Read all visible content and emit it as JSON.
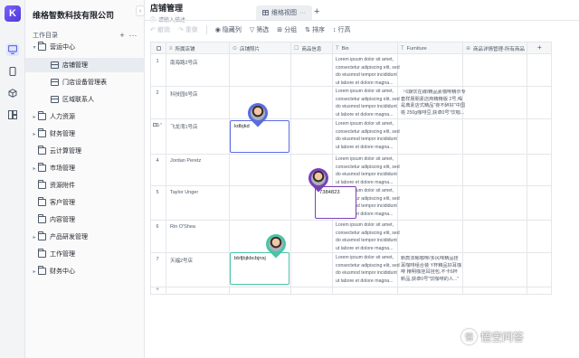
{
  "app": {
    "company_name": "维格智数科技有限公司",
    "logo_letter": "K",
    "collapse_glyph": "‹"
  },
  "directory": {
    "title": "工作目录",
    "add_glyph": "+",
    "more_glyph": "···",
    "items": [
      {
        "label": "营运中心",
        "caret": "▾",
        "type": "folder",
        "level": 0
      },
      {
        "label": "店铺管理",
        "caret": "",
        "type": "sheet",
        "level": 1,
        "selected": true
      },
      {
        "label": "门店设备管理表",
        "caret": "",
        "type": "sheet",
        "level": 1
      },
      {
        "label": "区域联系人",
        "caret": "",
        "type": "sheet",
        "level": 1
      },
      {
        "label": "人力资源",
        "caret": "▸",
        "type": "folder",
        "level": 0
      },
      {
        "label": "财务管理",
        "caret": "▸",
        "type": "folder",
        "level": 0
      },
      {
        "label": "云计算管理",
        "caret": "",
        "type": "folder",
        "level": 0
      },
      {
        "label": "市场管理",
        "caret": "▸",
        "type": "folder",
        "level": 0
      },
      {
        "label": "资源附件",
        "caret": "",
        "type": "folder",
        "level": 0
      },
      {
        "label": "客户管理",
        "caret": "",
        "type": "folder",
        "level": 0
      },
      {
        "label": "内容管理",
        "caret": "",
        "type": "folder",
        "level": 0
      },
      {
        "label": "产品研发管理",
        "caret": "▸",
        "type": "folder",
        "level": 0
      },
      {
        "label": "工作管理",
        "caret": "",
        "type": "folder",
        "level": 0
      },
      {
        "label": "财务中心",
        "caret": "▸",
        "type": "folder",
        "level": 0
      }
    ]
  },
  "header": {
    "sheet_name": "店铺管理",
    "sheet_desc": "请输入描述",
    "view_tab_label": "维格视图",
    "view_tab_more": "···",
    "add_view_glyph": "+"
  },
  "toolbar": {
    "undo": "撤销",
    "redo": "重做",
    "hide_columns": "隐藏列",
    "filter": "筛选",
    "group": "分组",
    "sort": "排序",
    "row_height": "行高"
  },
  "grid": {
    "columns": [
      {
        "icon": "≡",
        "label": "所属店铺"
      },
      {
        "icon": "⊙",
        "label": "店铺照片"
      },
      {
        "icon": "☐",
        "label": "商品信息"
      },
      {
        "icon": "T",
        "label": "Bio"
      },
      {
        "icon": "T",
        "label": "Furniture"
      },
      {
        "icon": "⊕",
        "label": "商品详情管理-所有商品"
      }
    ],
    "add_column_glyph": "+",
    "rows": [
      {
        "num": "1",
        "name": "南海路2号店",
        "lorem": [
          "Lorem ipsum dolor sit amet,",
          "consectetur adipiscing elit, sed",
          "do eiusmod tempor incididunt",
          "ut labore et dolore magna..."
        ],
        "furniture": []
      },
      {
        "num": "2",
        "name": "科技园6号店",
        "lorem": [
          "Lorem ipsum dolor sit amet,",
          "consectetur adipiscing elit, sed",
          "do eiusmod tempor incididunt",
          "ut labore et dolore magna..."
        ],
        "furniture": [
          "「6期饮在線/精品素咖啡精示专",
          "套样朋朋素店商精精版 2号,喝",
          "是典素店式精品\"夜不醉好\"中国",
          "桃 250g咖啡豆,获卓0号\"饮咖..."
        ]
      },
      {
        "num": "3",
        "name": "飞龙湾1号店",
        "lorem": [
          "Lorem ipsum dolor sit amet,",
          "consectetur adipiscing elit, sed",
          "do eiusmod tempor incididunt",
          "ut labore et dolore magna..."
        ],
        "furniture": []
      },
      {
        "num": "4",
        "name": "Jordan Peretz",
        "lorem": [
          "Lorem ipsum dolor sit amet,",
          "consectetur adipiscing elit, sed",
          "do eiusmod tempor incididunt",
          "ut labore et dolore magna..."
        ],
        "furniture": []
      },
      {
        "num": "5",
        "name": "Taylor Unger",
        "lorem": [
          "Lorem ipsum dolor sit amet,",
          "consectetur adipiscing elit, sed",
          "do eiusmod tempor incididunt",
          "ut labore et dolore magna..."
        ],
        "furniture": []
      },
      {
        "num": "6",
        "name": "Rin O'Shea",
        "lorem": [
          "Lorem ipsum dolor sit amet,",
          "consectetur adipiscing elit, sed",
          "do eiusmod tempor incididunt",
          "ut labore et dolore magna..."
        ],
        "furniture": []
      },
      {
        "num": "7",
        "name": "天福2号店",
        "lorem": [
          "Lorem ipsum dolor sit amet,",
          "consectetur adipiscing elit, sed",
          "do eiusmod tempor incididunt",
          "ut labore et dolore magna..."
        ],
        "furniture": [
          "新款浓郁咖啡/多风味精品挂",
          "耳咖啡组合装 Y杯精品好耳咖",
          "啡 精明咖挂耳挂包,不卡6杯",
          "新品,获卓0号\"饮咖啡的人...\""
        ]
      }
    ],
    "add_row_glyph": "+"
  },
  "collab": {
    "editors": [
      {
        "color": "#5b6be0",
        "text": "kdbjkd"
      },
      {
        "color": "#7a3fb8",
        "text": "7384823"
      },
      {
        "color": "#4bc4a7",
        "text": "bbfjbjkbcbjnsj"
      }
    ]
  },
  "watermark": {
    "circle_glyph": "悟",
    "text": "悟空问答"
  },
  "colors": {
    "accent": "#5b6be0",
    "rail_bg": "#f3f4f6",
    "border": "#e5e6eb"
  }
}
